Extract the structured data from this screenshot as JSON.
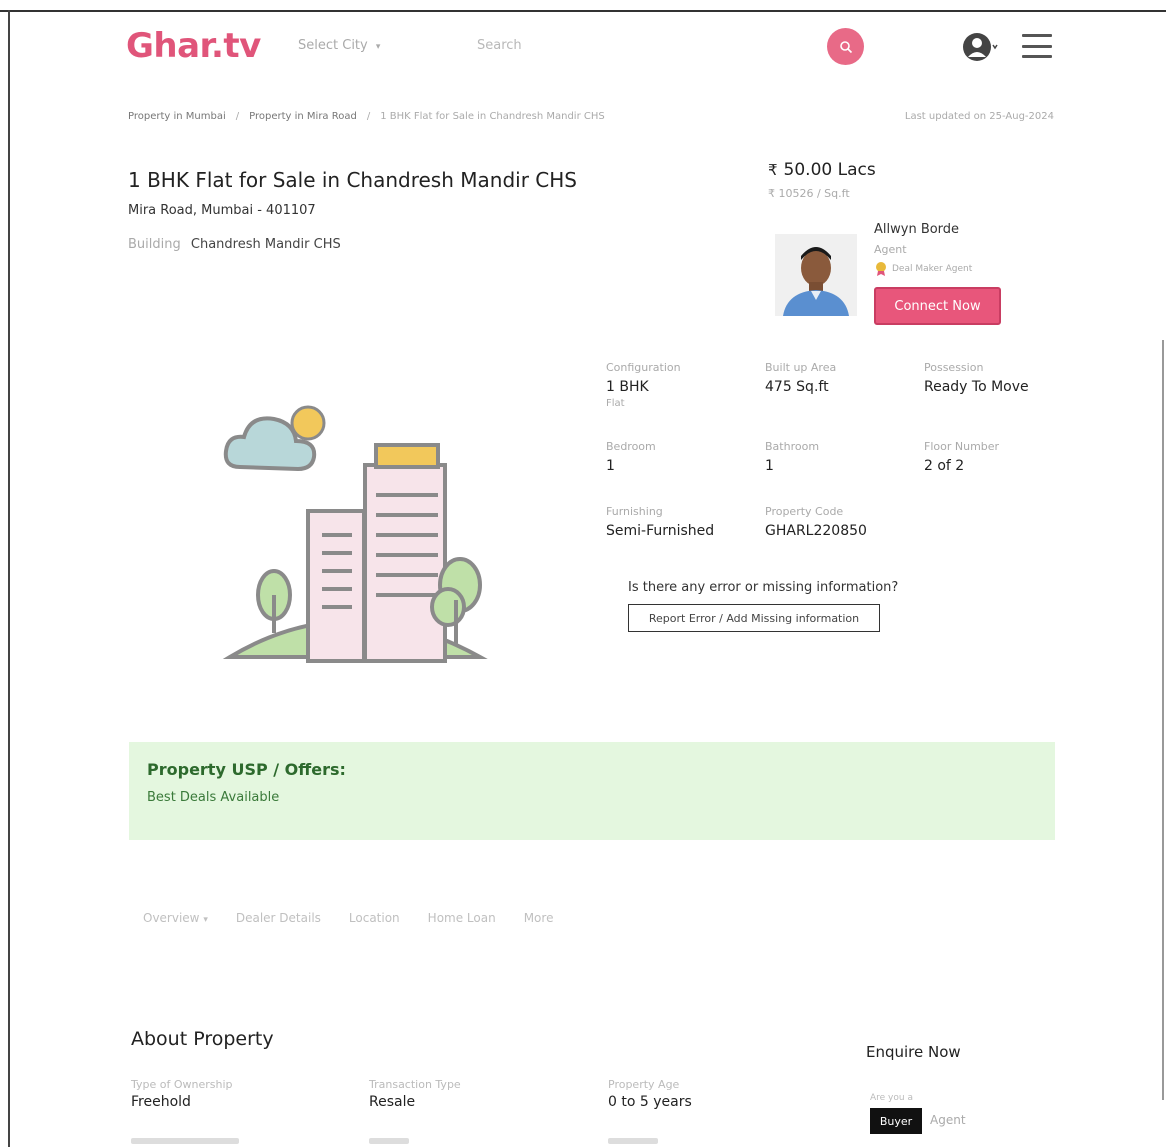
{
  "header": {
    "logo": "Ghar.tv",
    "city_select": "Select City",
    "search_placeholder": "Search"
  },
  "breadcrumb": {
    "items": [
      "Property in Mumbai",
      "Property in Mira Road",
      "1 BHK Flat for Sale in Chandresh Mandir CHS"
    ],
    "last_updated": "Last updated on 25-Aug-2024"
  },
  "property": {
    "title": "1 BHK Flat for Sale in Chandresh Mandir CHS",
    "location": "Mira Road, Mumbai - 401107",
    "building_label": "Building",
    "building_value": "Chandresh Mandir CHS",
    "price": "50.00 Lacs",
    "price_per_sqft": "₹ 10526 / Sq.ft"
  },
  "agent": {
    "name": "Allwyn Borde",
    "role": "Agent",
    "badge": "Deal Maker Agent",
    "connect_label": "Connect Now"
  },
  "specs": {
    "configuration": {
      "label": "Configuration",
      "value": "1 BHK",
      "sub": "Flat"
    },
    "built_up": {
      "label": "Built up Area",
      "value": "475 Sq.ft"
    },
    "possession": {
      "label": "Possession",
      "value": "Ready To Move"
    },
    "bedroom": {
      "label": "Bedroom",
      "value": "1"
    },
    "bathroom": {
      "label": "Bathroom",
      "value": "1"
    },
    "floor": {
      "label": "Floor Number",
      "value": "2 of 2"
    },
    "furnishing": {
      "label": "Furnishing",
      "value": "Semi-Furnished"
    },
    "code": {
      "label": "Property Code",
      "value": "GHARL220850"
    }
  },
  "error_section": {
    "question": "Is there any error or missing information?",
    "button": "Report Error / Add Missing information"
  },
  "usp": {
    "title": "Property USP / Offers:",
    "text": "Best Deals Available"
  },
  "tabs": [
    "Overview",
    "Dealer Details",
    "Location",
    "Home Loan",
    "More"
  ],
  "about": {
    "title": "About Property",
    "ownership": {
      "label": "Type of Ownership",
      "value": "Freehold"
    },
    "transaction": {
      "label": "Transaction Type",
      "value": "Resale"
    },
    "age": {
      "label": "Property Age",
      "value": "0 to 5 years"
    }
  },
  "enquire": {
    "title": "Enquire Now",
    "question": "Are you a",
    "buyer_label": "Buyer",
    "agent_label": "Agent"
  },
  "colors": {
    "brand": "#e0557a",
    "connect_button": "#e8567b",
    "usp_bg": "#e4f7df",
    "usp_title": "#2d6a2d"
  },
  "icons": {
    "search": "search-icon",
    "user": "user-icon",
    "menu": "hamburger-menu-icon",
    "badge": "medal-icon"
  }
}
